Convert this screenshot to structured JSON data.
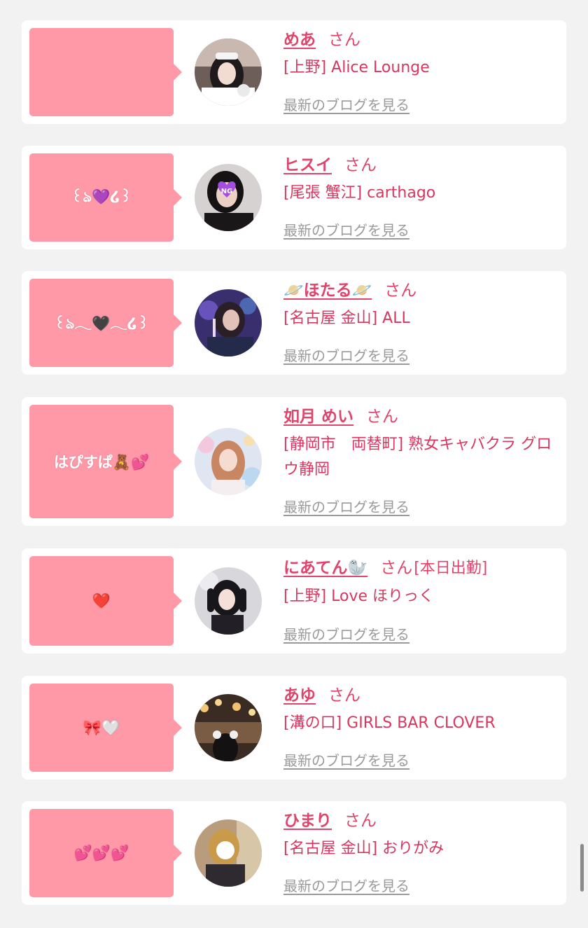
{
  "suffix_san": "さん",
  "blog_link_label": "最新のブログを見る",
  "colors": {
    "accent": "#e0446b",
    "bubble": "#ff99a8",
    "link_gray": "#9a9a9a",
    "background": "#f2f2f2"
  },
  "girls": [
    {
      "name": "めあ",
      "bubble": "",
      "shop": "[上野] Alice Lounge",
      "status": ""
    },
    {
      "name": "ヒスイ",
      "bubble": "꒰ঌ💜໒꒱",
      "shop": "[尾張 蟹江] carthago",
      "status": ""
    },
    {
      "name": "🪐ほたる🪐",
      "bubble": "꒰ঌ𓂃🖤𓂃໒꒱",
      "shop": "[名古屋 金山] ALL",
      "status": ""
    },
    {
      "name": "如月 めい",
      "bubble": "はぴすぱ🧸💕",
      "shop": "[静岡市　両替町] 熟女キャバクラ グロウ静岡",
      "status": ""
    },
    {
      "name": "にあてん🦭",
      "bubble": "❤️",
      "shop": "[上野] Love ほりっく",
      "status": "[本日出勤]"
    },
    {
      "name": "あゆ",
      "bubble": "🎀🤍",
      "shop": "[溝の口] GIRLS BAR CLOVER",
      "status": ""
    },
    {
      "name": "ひまり",
      "bubble": "💕💕💕",
      "shop": "[名古屋 金山] おりがみ",
      "status": ""
    }
  ]
}
